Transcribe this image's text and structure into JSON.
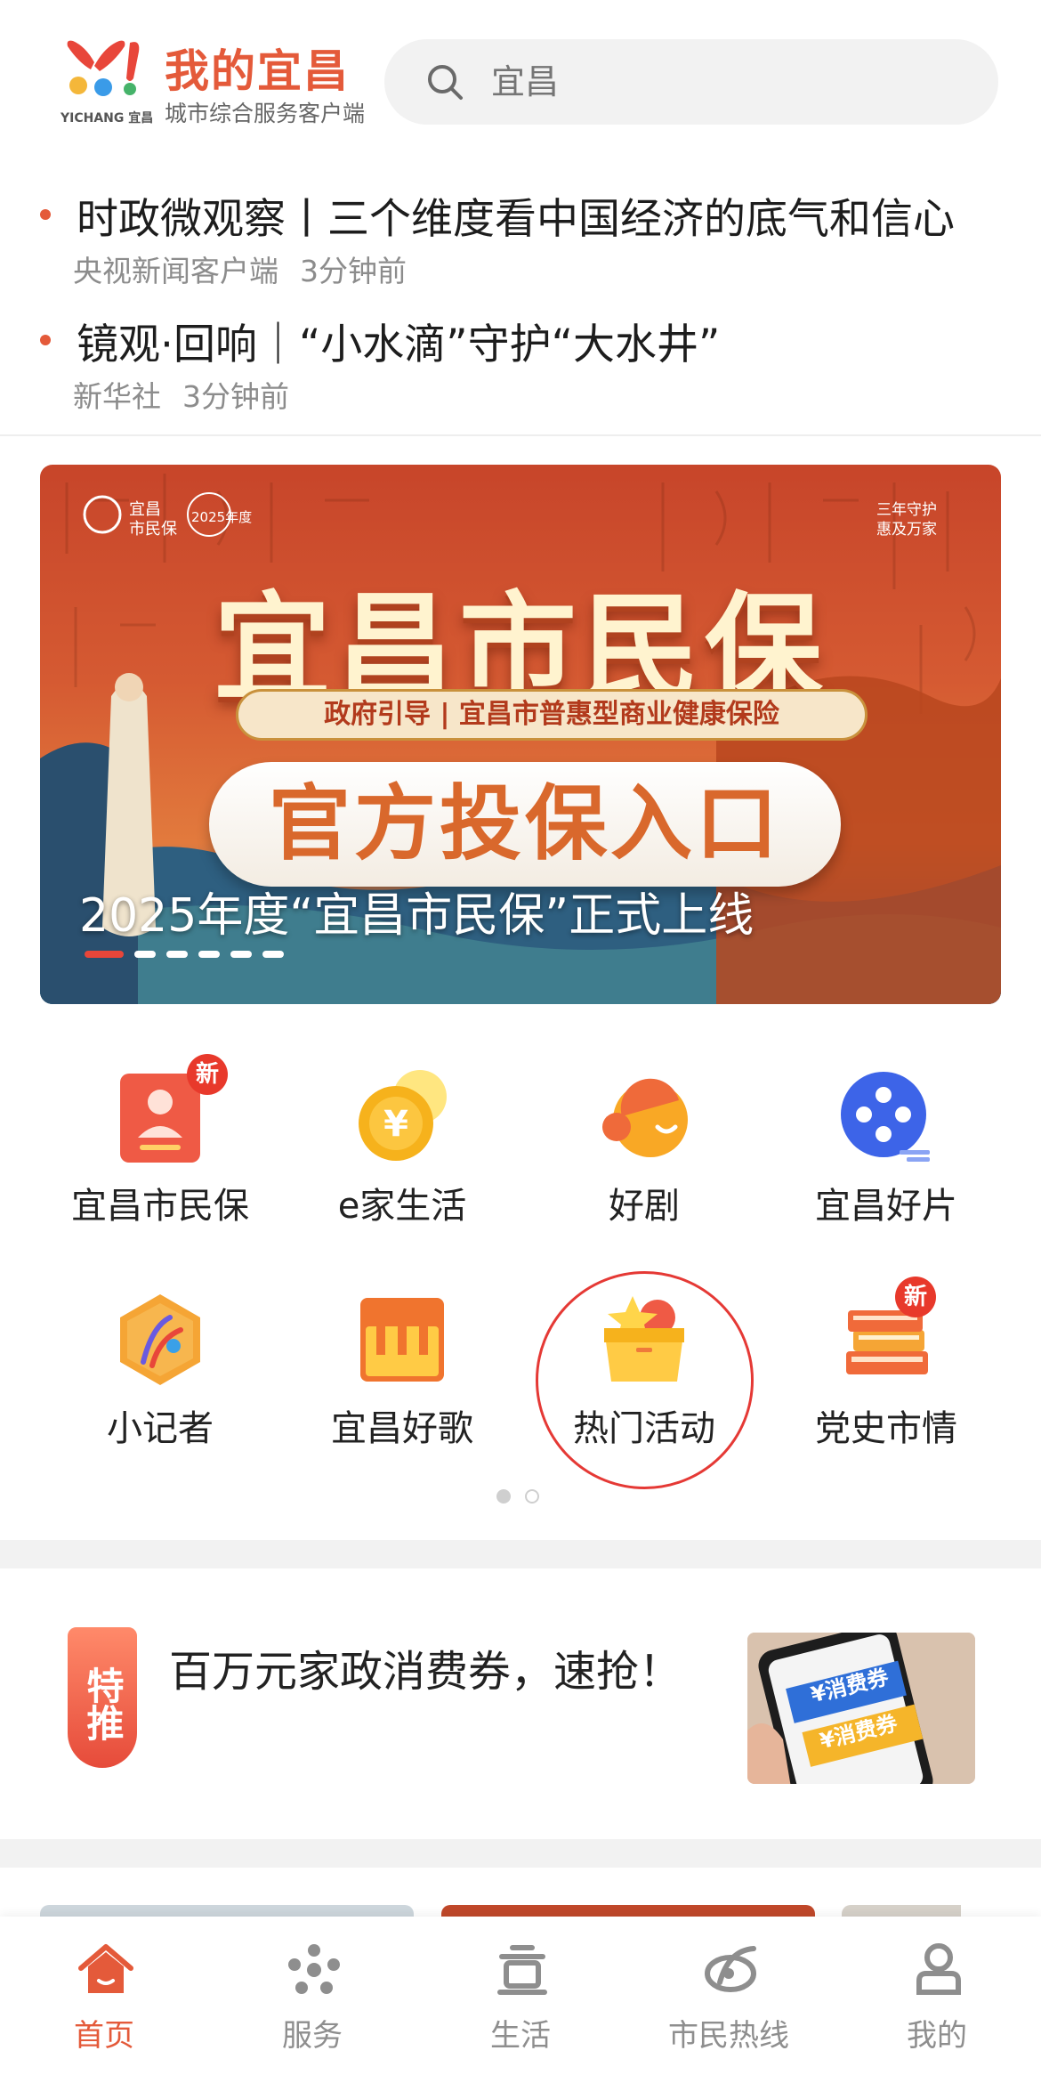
{
  "header": {
    "brand_title": "我的宜昌",
    "brand_subtitle": "城市综合服务客户端",
    "logo_text": "YICHANG 宜昌",
    "search_placeholder": "宜昌"
  },
  "news": [
    {
      "title": "时政微观察丨三个维度看中国经济的底气和信心",
      "source": "央视新闻客户端",
      "time": "3分钟前"
    },
    {
      "title": "镜观·回响｜“小水滴”守护“大水井”",
      "source": "新华社",
      "time": "3分钟前"
    }
  ],
  "banner": {
    "logo_text": "宜昌\n市民保",
    "year_badge": "2025年度",
    "corner_text": "三年守护\n惠及万家",
    "main_title": "宜昌市民保",
    "subtitle": "政府引导 | 宜昌市普惠型商业健康保险",
    "button_text": "官方投保入口",
    "caption": "2025年度“宜昌市民保”正式上线",
    "slide_count": 6,
    "active_slide": 1
  },
  "services": [
    {
      "label": "宜昌市民保",
      "icon": "insurance-card-icon",
      "badge": "新"
    },
    {
      "label": "e家生活",
      "icon": "coin-icon",
      "badge": ""
    },
    {
      "label": "好剧",
      "icon": "smile-face-icon",
      "badge": ""
    },
    {
      "label": "宜昌好片",
      "icon": "film-reel-icon",
      "badge": ""
    },
    {
      "label": "小记者",
      "icon": "reporter-hexagon-icon",
      "badge": ""
    },
    {
      "label": "宜昌好歌",
      "icon": "piano-keys-icon",
      "badge": ""
    },
    {
      "label": "热门活动",
      "icon": "star-box-icon",
      "badge": ""
    },
    {
      "label": "党史市情",
      "icon": "books-icon",
      "badge": "新"
    }
  ],
  "services_pages": {
    "count": 2,
    "active": 1
  },
  "promo": {
    "tag": "特推",
    "text": "百万元家政消费券，速抢！",
    "image_text_1": "¥消费券",
    "image_text_2": "¥消费券"
  },
  "tabbar": [
    {
      "label": "首页",
      "icon": "home-icon",
      "active": true
    },
    {
      "label": "服务",
      "icon": "service-icon",
      "active": false
    },
    {
      "label": "生活",
      "icon": "life-icon",
      "active": false
    },
    {
      "label": "市民热线",
      "icon": "hotline-icon",
      "active": false
    },
    {
      "label": "我的",
      "icon": "profile-icon",
      "active": false
    }
  ],
  "colors": {
    "accent": "#e45a3a",
    "inactive": "#8e8e8e",
    "badge": "#e8392b"
  }
}
